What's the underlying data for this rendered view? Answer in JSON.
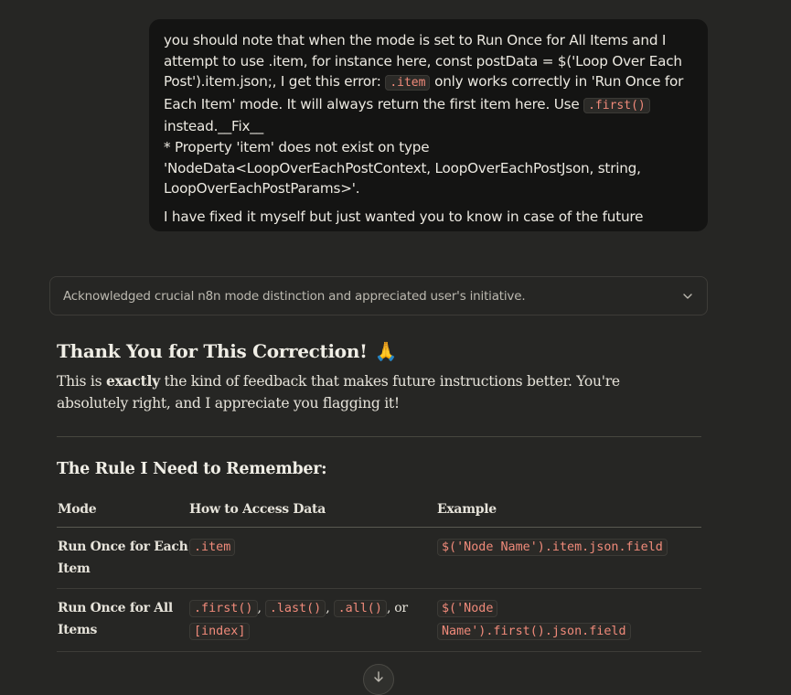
{
  "user_message": {
    "paragraph1_parts": [
      "you should note that when the mode is set to Run Once for All Items and I attempt to use .item, for instance here, const postData = $('Loop Over Each Post').item.json;, I get this error: ",
      ".item",
      " only works correctly in 'Run Once for Each Item' mode. It will always return the first item here. Use ",
      ".first()",
      " instead.__Fix__",
      "* Property 'item' does not exist on type 'NodeData<LoopOverEachPostContext, LoopOverEachPostJson, string, LoopOverEachPostParams>'."
    ],
    "paragraph2": "I have fixed it myself but just wanted you to know in case of the future"
  },
  "thinking": {
    "summary": "Acknowledged crucial n8n mode distinction and appreciated user's initiative.",
    "icon": "chevron-down-icon"
  },
  "response": {
    "title": "Thank You for This Correction!",
    "title_emoji": "🙏",
    "intro_before": "This is ",
    "intro_bold": "exactly",
    "intro_after": " the kind of feedback that makes future instructions better. You're absolutely right, and I appreciate you flagging it!",
    "rule_heading": "The Rule I Need to Remember:",
    "table": {
      "headers": [
        "Mode",
        "How to Access Data",
        "Example"
      ],
      "row1": {
        "mode": "Run Once for Each Item",
        "access": ".item",
        "example": "$('Node Name').item.json.field"
      },
      "row2": {
        "mode": "Run Once for All Items",
        "access_first": ".first()",
        "sep1": ", ",
        "access_last": ".last()",
        "sep2": ", ",
        "access_all": ".all()",
        "sep3": ", or",
        "access_index": "[index]",
        "example_line1": "$('Node",
        "example_line2": "Name').first().json.field"
      }
    }
  },
  "scroll_button": {
    "icon": "arrow-down-icon"
  },
  "colors": {
    "background": "#262624",
    "user_bubble": "#141413",
    "code_text": "#f08a7a"
  }
}
